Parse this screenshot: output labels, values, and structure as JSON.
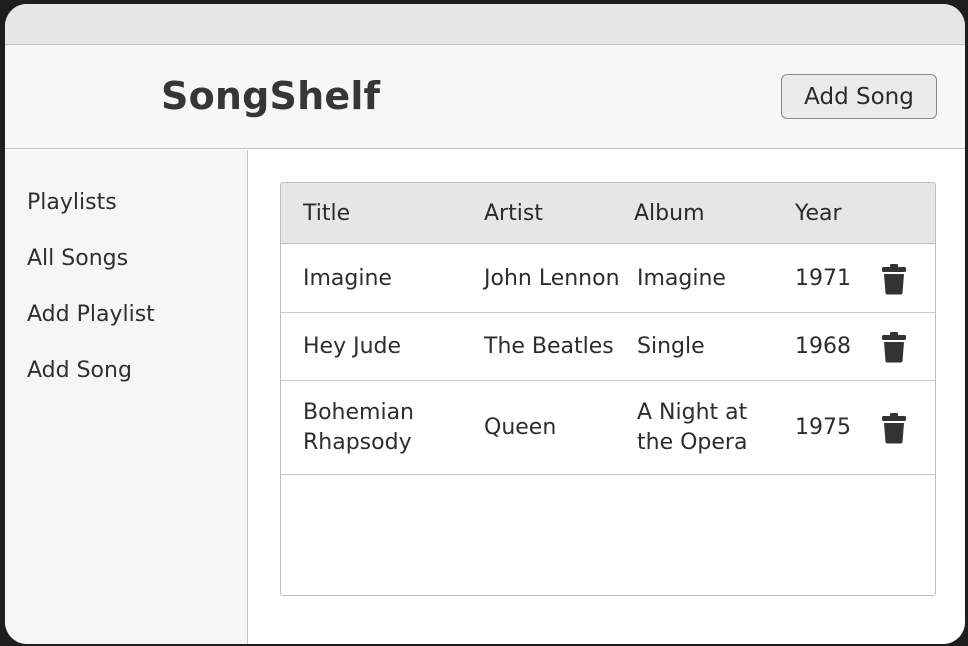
{
  "app": {
    "title": "SongShelf"
  },
  "header": {
    "add_song_label": "Add Song"
  },
  "sidebar": {
    "items": [
      {
        "label": "Playlists"
      },
      {
        "label": "All Songs"
      },
      {
        "label": "Add Playlist"
      },
      {
        "label": "Add Song"
      }
    ]
  },
  "table": {
    "columns": [
      "Title",
      "Artist",
      "Album",
      "Year"
    ],
    "rows": [
      {
        "title": [
          "Imagine"
        ],
        "artist": [
          "John Lennon"
        ],
        "album": [
          "Imagine"
        ],
        "year": "1971",
        "action_icon": "trash-icon"
      },
      {
        "title": [
          "Hey Jude"
        ],
        "artist": [
          "The Beatles"
        ],
        "album": [
          "Single"
        ],
        "year": "1968",
        "action_icon": "trash-icon"
      },
      {
        "title": [
          "Bohemian",
          "Rhapsody"
        ],
        "artist": [
          "Queen"
        ],
        "album": [
          "A Night at",
          "the Opera"
        ],
        "year": "1975",
        "action_icon": "trash-icon"
      }
    ]
  },
  "colors": {
    "icon": "#333333",
    "header_bg": "#e6e6e6",
    "border": "#bdbdbd"
  }
}
